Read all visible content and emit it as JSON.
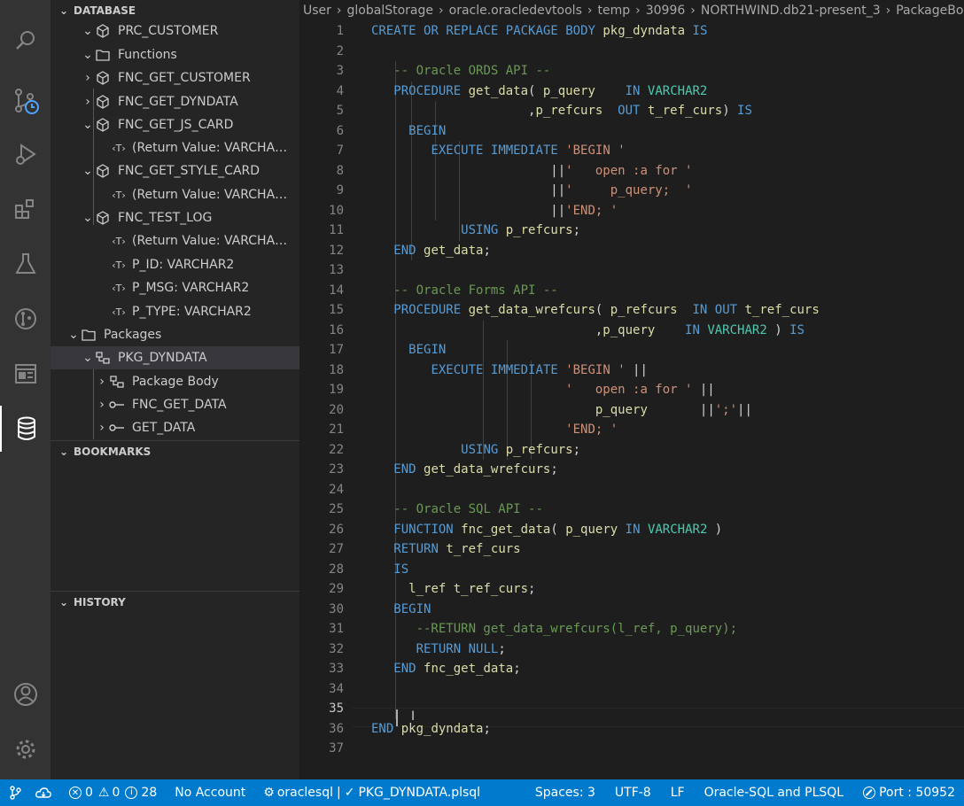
{
  "sidebar": {
    "database_header": "DATABASE",
    "bookmarks_header": "BOOKMARKS",
    "history_header": "HISTORY",
    "tree": {
      "prc_customer": "PRC_CUSTOMER",
      "functions": "Functions",
      "fnc_get_customer": "FNC_GET_CUSTOMER",
      "fnc_get_dyndata": "FNC_GET_DYNDATA",
      "fnc_get_js_card": "FNC_GET_JS_CARD",
      "ret_value_1": "(Return Value: VARCHA…",
      "fnc_get_style_card": "FNC_GET_STYLE_CARD",
      "ret_value_2": "(Return Value: VARCHA…",
      "fnc_test_log": "FNC_TEST_LOG",
      "ret_value_3": "(Return Value: VARCHA…",
      "p_id": "P_ID: VARCHAR2",
      "p_msg": "P_MSG: VARCHAR2",
      "p_type": "P_TYPE: VARCHAR2",
      "packages": "Packages",
      "pkg_dyndata": "PKG_DYNDATA",
      "package_body": "Package Body",
      "fnc_get_data": "FNC_GET_DATA",
      "get_data": "GET_DATA"
    }
  },
  "breadcrumb": [
    "User",
    "globalStorage",
    "oracle.oracledevtools",
    "temp",
    "30996",
    "NORTHWIND.db21-present_3",
    "PackageBody"
  ],
  "editor": {
    "line_numbers": [
      "1",
      "2",
      "3",
      "4",
      "5",
      "6",
      "7",
      "8",
      "9",
      "10",
      "11",
      "12",
      "13",
      "14",
      "15",
      "16",
      "17",
      "18",
      "19",
      "20",
      "21",
      "22",
      "23",
      "24",
      "25",
      "26",
      "27",
      "28",
      "29",
      "30",
      "31",
      "32",
      "33",
      "34",
      "35",
      "36",
      "37"
    ],
    "code_lines": [
      "CREATE OR REPLACE PACKAGE BODY pkg_dyndata IS",
      "",
      "   -- Oracle ORDS API --",
      "   PROCEDURE get_data( p_query    IN VARCHAR2",
      "                     ,p_refcurs  OUT t_ref_curs) IS",
      "     BEGIN",
      "        EXECUTE IMMEDIATE 'BEGIN '",
      "                        ||'   open :a for '",
      "                        ||'     p_query;  '",
      "                        ||'END; '",
      "            USING p_refcurs;",
      "   END get_data;",
      "",
      "   -- Oracle Forms API --",
      "   PROCEDURE get_data_wrefcurs( p_refcurs  IN OUT t_ref_curs",
      "                              ,p_query    IN VARCHAR2 ) IS",
      "     BEGIN",
      "        EXECUTE IMMEDIATE 'BEGIN ' ||",
      "                          '   open :a for ' ||",
      "                              p_query       ||';'||",
      "                          'END; '",
      "            USING p_refcurs;",
      "   END get_data_wrefcurs;",
      "",
      "   -- Oracle SQL API --",
      "   FUNCTION fnc_get_data( p_query IN VARCHAR2 )",
      "   RETURN t_ref_curs",
      "   IS",
      "     l_ref t_ref_curs;",
      "   BEGIN",
      "      --RETURN get_data_wrefcurs(l_ref, p_query);",
      "      RETURN NULL;",
      "   END fnc_get_data;",
      "",
      "",
      "END pkg_dyndata;",
      ""
    ],
    "current_line": "35"
  },
  "statusbar": {
    "errors": "0",
    "warnings": "0",
    "infos": "28",
    "account": "No Account",
    "connection": "oraclesql",
    "file": "PKG_DYNDATA.plsql",
    "spaces": "Spaces: 3",
    "encoding": "UTF-8",
    "eol": "LF",
    "language": "Oracle-SQL and PLSQL",
    "port": "Port : 50952"
  },
  "colors": {
    "statusbar": "#007acc",
    "keyword": "#569cd6",
    "type": "#4ec9b0",
    "string": "#ce9178",
    "comment": "#6a9955",
    "function": "#dcdcaa"
  }
}
